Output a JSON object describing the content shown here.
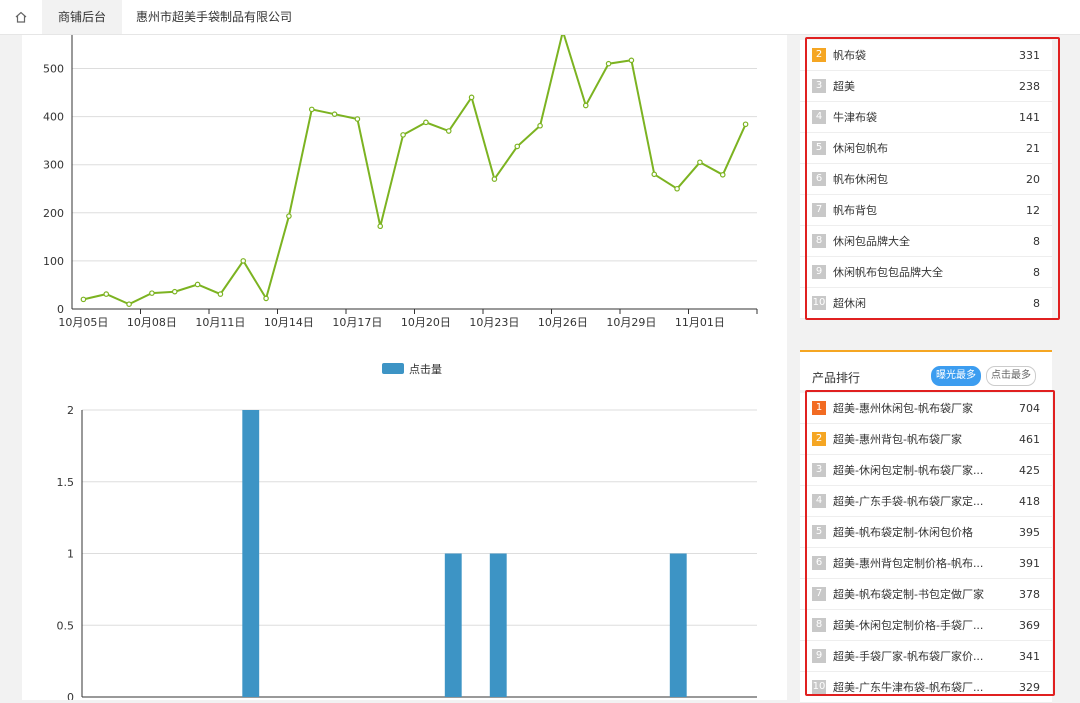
{
  "topbar": {
    "home_icon": "home-icon",
    "tab_active": "商铺后台",
    "company": "惠州市超美手袋制品有限公司"
  },
  "keyword_rank": [
    {
      "no": "2",
      "name": "帆布袋",
      "value": "331"
    },
    {
      "no": "3",
      "name": "超美",
      "value": "238"
    },
    {
      "no": "4",
      "name": "牛津布袋",
      "value": "141"
    },
    {
      "no": "5",
      "name": "休闲包帆布",
      "value": "21"
    },
    {
      "no": "6",
      "name": "帆布休闲包",
      "value": "20"
    },
    {
      "no": "7",
      "name": "帆布背包",
      "value": "12"
    },
    {
      "no": "8",
      "name": "休闲包品牌大全",
      "value": "8"
    },
    {
      "no": "9",
      "name": "休闲帆布包包品牌大全",
      "value": "8"
    },
    {
      "no": "10",
      "name": "超休闲",
      "value": "8"
    }
  ],
  "product_panel": {
    "title": "产品排行",
    "tab_exposure": "曝光最多",
    "tab_click": "点击最多"
  },
  "product_rank": [
    {
      "no": "1",
      "name": "超美-惠州休闲包-帆布袋厂家",
      "value": "704"
    },
    {
      "no": "2",
      "name": "超美-惠州背包-帆布袋厂家",
      "value": "461"
    },
    {
      "no": "3",
      "name": "超美-休闲包定制-帆布袋厂家...",
      "value": "425"
    },
    {
      "no": "4",
      "name": "超美-广东手袋-帆布袋厂家定...",
      "value": "418"
    },
    {
      "no": "5",
      "name": "超美-帆布袋定制-休闲包价格",
      "value": "395"
    },
    {
      "no": "6",
      "name": "超美-惠州背包定制价格-帆布...",
      "value": "391"
    },
    {
      "no": "7",
      "name": "超美-帆布袋定制-书包定做厂家",
      "value": "378"
    },
    {
      "no": "8",
      "name": "超美-休闲包定制价格-手袋厂...",
      "value": "369"
    },
    {
      "no": "9",
      "name": "超美-手袋厂家-帆布袋厂家价...",
      "value": "341"
    },
    {
      "no": "10",
      "name": "超美-广东牛津布袋-帆布袋厂...",
      "value": "329"
    }
  ],
  "chart_data": [
    {
      "type": "line",
      "color": "#7cb321",
      "x": [
        "10月05日",
        "10月06日",
        "10月07日",
        "10月08日",
        "10月09日",
        "10月10日",
        "10月11日",
        "10月12日",
        "10月13日",
        "10月14日",
        "10月15日",
        "10月16日",
        "10月17日",
        "10月18日",
        "10月19日",
        "10月20日",
        "10月21日",
        "10月22日",
        "10月23日",
        "10月24日",
        "10月25日",
        "10月26日",
        "10月27日",
        "10月28日",
        "10月29日",
        "10月30日",
        "10月31日",
        "11月01日",
        "11月02日",
        "11月03日"
      ],
      "values": [
        20,
        31,
        10,
        33,
        36,
        51,
        31,
        100,
        22,
        193,
        415,
        405,
        395,
        172,
        362,
        388,
        370,
        440,
        270,
        338,
        381,
        577,
        423,
        510,
        517,
        280,
        250,
        305,
        279,
        384
      ],
      "xticks": [
        "10月05日",
        "10月08日",
        "10月11日",
        "10月14日",
        "10月17日",
        "10月20日",
        "10月23日",
        "10月26日",
        "10月29日",
        "11月01日"
      ],
      "yticks": [
        0,
        100,
        200,
        300,
        400,
        500
      ],
      "ylim": [
        0,
        580
      ]
    },
    {
      "type": "bar",
      "color": "#3d94c5",
      "legend": "点击量",
      "values": [
        0,
        0,
        0,
        0,
        0,
        0,
        0,
        2,
        0,
        0,
        0,
        0,
        0,
        0,
        0,
        0,
        1,
        0,
        1,
        0,
        0,
        0,
        0,
        0,
        0,
        0,
        1,
        0,
        0,
        0
      ],
      "yticks": [
        "0",
        "0.5",
        "1",
        "1.5",
        "2"
      ],
      "ylim": [
        0,
        2
      ]
    }
  ]
}
